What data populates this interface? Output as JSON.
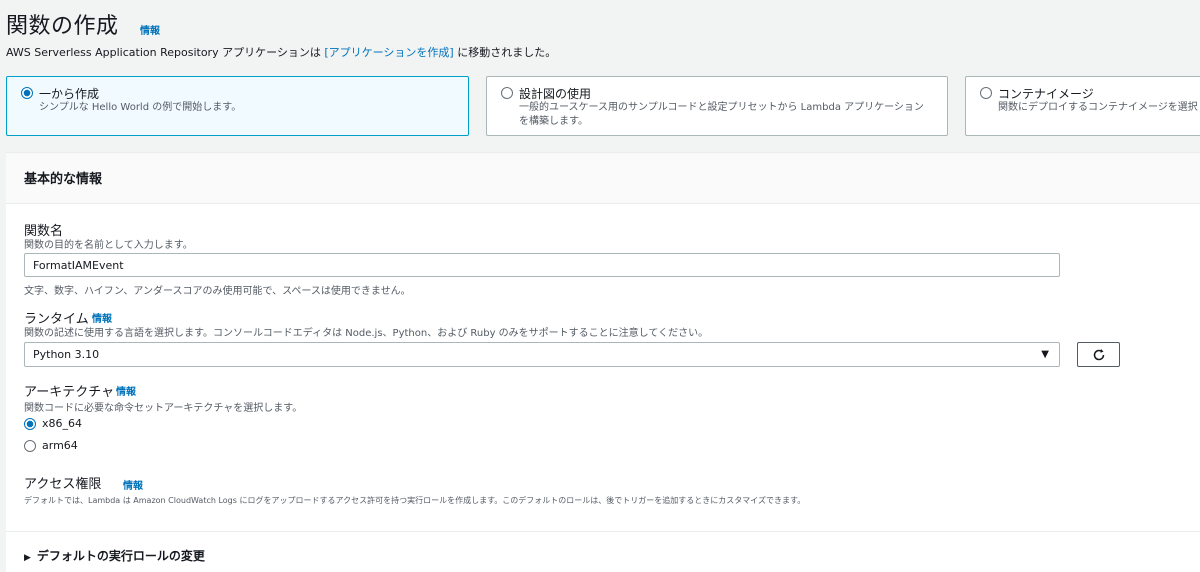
{
  "header": {
    "title": "関数の作成",
    "info_link": "情報",
    "subtitle_prefix": "AWS Serverless Application Repository アプリケーションは",
    "subtitle_link": "[アプリケーションを作成]",
    "subtitle_suffix": "に移動されました。"
  },
  "creation_options": [
    {
      "label": "一から作成",
      "description": "シンプルな Hello World の例で開始します。",
      "selected": true
    },
    {
      "label": "設計図の使用",
      "description": "一般的ユースケース用のサンプルコードと設定プリセットから Lambda アプリケーションを構築します。",
      "selected": false
    },
    {
      "label": "コンテナイメージ",
      "description": "関数にデプロイするコンテナイメージを選択",
      "selected": false
    }
  ],
  "basic_info": {
    "title": "基本的な情報",
    "function_name": {
      "label": "関数名",
      "description": "関数の目的を名前として入力します。",
      "value": "FormatIAMEvent",
      "constraint": "文字、数字、ハイフン、アンダースコアのみ使用可能で、スペースは使用できません。"
    },
    "runtime": {
      "label": "ランタイム",
      "info": "情報",
      "description": "関数の記述に使用する言語を選択します。コンソールコードエディタは Node.js、Python、および Ruby のみをサポートすることに注意してください。",
      "value": "Python 3.10"
    },
    "architecture": {
      "label": "アーキテクチャ",
      "info": "情報",
      "description": "関数コードに必要な命令セットアーキテクチャを選択します。",
      "options": [
        {
          "label": "x86_64",
          "selected": true
        },
        {
          "label": "arm64",
          "selected": false
        }
      ]
    },
    "permissions": {
      "label": "アクセス権限",
      "info": "情報",
      "description": "デフォルトでは、Lambda は Amazon CloudWatch Logs にログをアップロードするアクセス許可を持つ実行ロールを作成します。このデフォルトのロールは、後でトリガーを追加するときにカスタマイズできます。"
    },
    "expander_label": "デフォルトの実行ロールの変更"
  },
  "colors": {
    "accent": "#0073bb",
    "selected_tile_bg": "#f1faff",
    "selected_tile_border": "#00a1c9"
  }
}
